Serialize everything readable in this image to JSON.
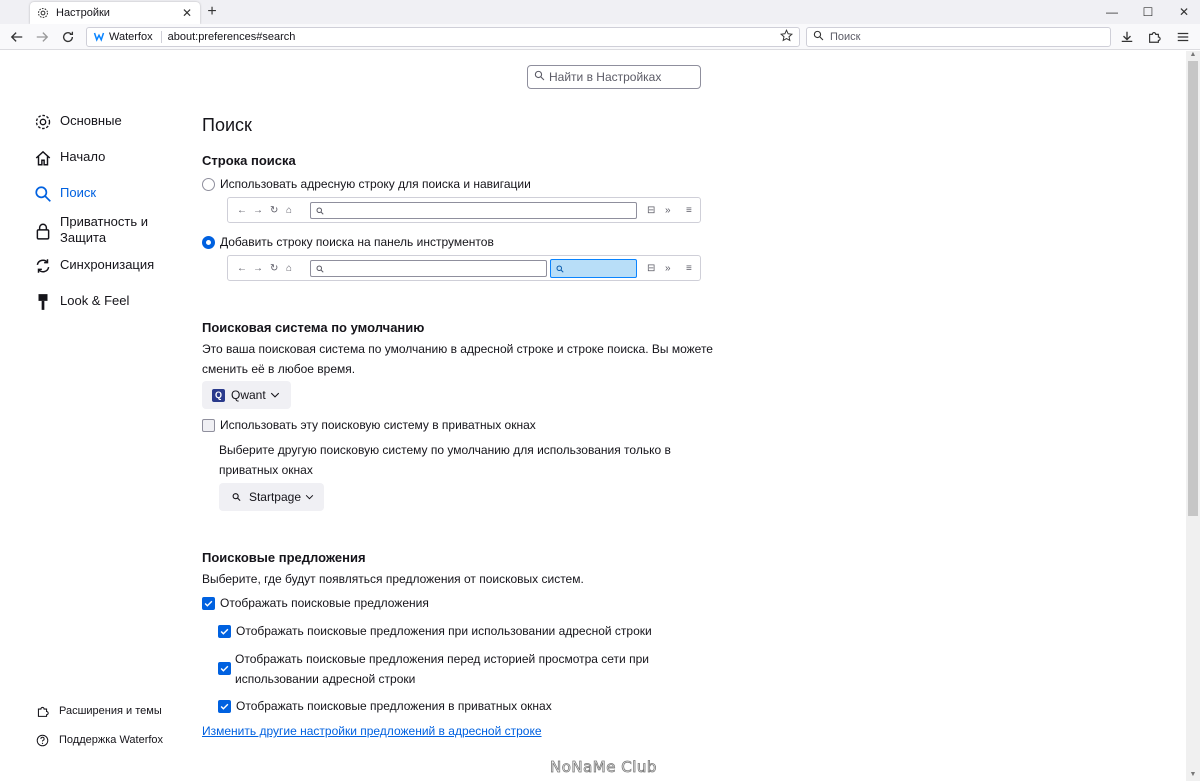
{
  "tab": {
    "title": "Настройки",
    "close": "✕"
  },
  "window_controls": {
    "minimize": "—",
    "maximize": "☐",
    "close": "✕"
  },
  "newtab": "+",
  "urlbar": {
    "brand": "Waterfox",
    "url": "about:preferences#search"
  },
  "searchbar": {
    "placeholder": "Поиск"
  },
  "prefs_search": {
    "placeholder": "Найти в Настройках"
  },
  "sidebar": {
    "items": [
      {
        "label": "Основные",
        "icon": "gear-icon"
      },
      {
        "label": "Начало",
        "icon": "home-icon"
      },
      {
        "label": "Поиск",
        "icon": "search-icon",
        "selected": true
      },
      {
        "label": "Приватность и",
        "label2": "Защита",
        "icon": "lock-icon"
      },
      {
        "label": "Синхронизация",
        "icon": "sync-icon"
      },
      {
        "label": "Look & Feel",
        "icon": "paintbrush-icon"
      }
    ],
    "footer": [
      {
        "label": "Расширения и темы",
        "icon": "puzzle-icon"
      },
      {
        "label": "Поддержка Waterfox",
        "icon": "help-icon"
      }
    ]
  },
  "page": {
    "title": "Поиск",
    "searchbar_section": {
      "heading": "Строка поиска",
      "option1": "Использовать адресную строку для поиска и навигации",
      "option2": "Добавить строку поиска на панель инструментов",
      "selected": 2
    },
    "default_engine": {
      "heading": "Поисковая система по умолчанию",
      "desc_line1": "Это ваша поисковая система по умолчанию в адресной строке и строке поиска. Вы можете",
      "desc_line2": "сменить её в любое время.",
      "engine": "Qwant",
      "private_checkbox": "Использовать эту поисковую систему в приватных окнах",
      "private_checked": false,
      "private_desc_line1": "Выберите другую поисковую систему по умолчанию для использования только в",
      "private_desc_line2": "приватных окнах",
      "private_engine": "Startpage"
    },
    "suggestions": {
      "heading": "Поисковые предложения",
      "desc": "Выберите, где будут появляться предложения от поисковых систем.",
      "show": "Отображать поисковые предложения",
      "in_urlbar": "Отображать поисковые предложения при использовании адресной строки",
      "before_history_line1": "Отображать поисковые предложения перед историей просмотра сети при",
      "before_history_line2": "использовании адресной строки",
      "in_private": "Отображать поисковые предложения в приватных окнах",
      "link": "Изменить другие настройки предложений в адресной строке"
    }
  },
  "watermark": "NoNaMe Club",
  "colors": {
    "accent": "#0061e0",
    "text": "#15141a"
  }
}
